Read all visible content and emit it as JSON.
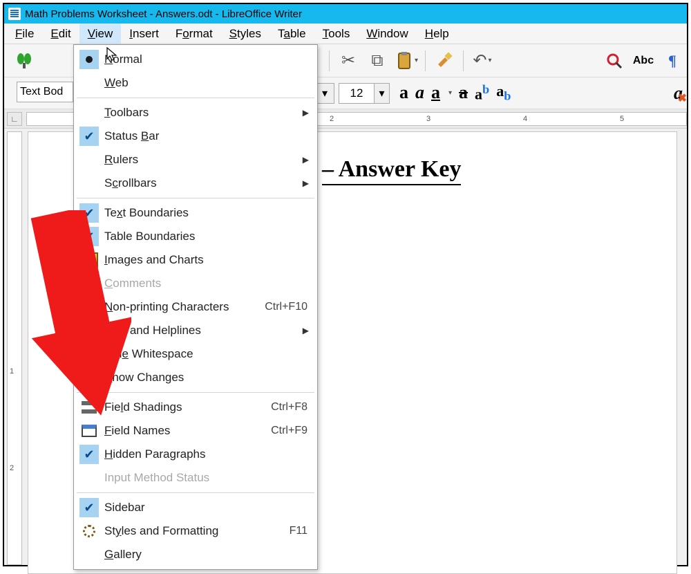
{
  "titlebar": {
    "text": "Math Problems Worksheet - Answers.odt - LibreOffice Writer"
  },
  "menubar": {
    "items": [
      {
        "label": "File",
        "u": "F"
      },
      {
        "label": "Edit",
        "u": "E"
      },
      {
        "label": "View",
        "u": "V"
      },
      {
        "label": "Insert",
        "u": "I"
      },
      {
        "label": "Format",
        "u": "o"
      },
      {
        "label": "Styles",
        "u": "S"
      },
      {
        "label": "Table",
        "u": "a"
      },
      {
        "label": "Tools",
        "u": "T"
      },
      {
        "label": "Window",
        "u": "W"
      },
      {
        "label": "Help",
        "u": "H"
      }
    ],
    "open_index": 2
  },
  "view_menu": {
    "items": [
      {
        "label": "Normal",
        "u": "N",
        "icon": "radio",
        "kind": "item"
      },
      {
        "label": "Web",
        "u": "W",
        "icon": "",
        "kind": "item"
      },
      {
        "kind": "sep"
      },
      {
        "label": "Toolbars",
        "u": "T",
        "icon": "",
        "kind": "submenu"
      },
      {
        "label": "Status Bar",
        "u": "B",
        "icon": "check",
        "kind": "item"
      },
      {
        "label": "Rulers",
        "u": "R",
        "icon": "",
        "kind": "submenu"
      },
      {
        "label": "Scrollbars",
        "u": "c",
        "icon": "",
        "kind": "submenu"
      },
      {
        "kind": "sep"
      },
      {
        "label": "Text Boundaries",
        "u": "x",
        "icon": "check",
        "kind": "item"
      },
      {
        "label": "Table Boundaries",
        "u": "",
        "icon": "check",
        "kind": "item"
      },
      {
        "label": "Images and Charts",
        "u": "I",
        "icon": "image",
        "kind": "item"
      },
      {
        "label": "Comments",
        "u": "C",
        "icon": "",
        "kind": "item",
        "disabled": true
      },
      {
        "label": "Non-printing Characters",
        "u": "N",
        "icon": "para",
        "shortcut": "Ctrl+F10",
        "kind": "item"
      },
      {
        "label": "Grid and Helplines",
        "u": "",
        "icon": "",
        "kind": "submenu"
      },
      {
        "label": "Hide Whitespace",
        "u": "e",
        "icon": "",
        "kind": "item"
      },
      {
        "label": "Show Changes",
        "u": "S",
        "icon": "",
        "kind": "item"
      },
      {
        "kind": "sep"
      },
      {
        "label": "Field Shadings",
        "u": "l",
        "icon": "fshade",
        "shortcut": "Ctrl+F8",
        "kind": "item"
      },
      {
        "label": "Field Names",
        "u": "F",
        "icon": "fnames",
        "shortcut": "Ctrl+F9",
        "kind": "item"
      },
      {
        "label": "Hidden Paragraphs",
        "u": "H",
        "icon": "check",
        "kind": "item"
      },
      {
        "label": "Input Method Status",
        "u": "",
        "icon": "",
        "kind": "item",
        "disabled": true
      },
      {
        "kind": "sep"
      },
      {
        "label": "Sidebar",
        "u": "k",
        "icon": "check",
        "kind": "item"
      },
      {
        "label": "Styles and Formatting",
        "u": "y",
        "icon": "gear",
        "shortcut": "F11",
        "kind": "item"
      },
      {
        "label": "Gallery",
        "u": "G",
        "icon": "",
        "kind": "item"
      }
    ]
  },
  "toolbar2": {
    "style_name": "Text Bod",
    "font_size": "12"
  },
  "ruler": {
    "ticks": [
      "2",
      "3",
      "4",
      "5"
    ]
  },
  "vruler": {
    "ticks": [
      "1",
      "2"
    ]
  },
  "document": {
    "heading_visible": "– Answer Key"
  }
}
